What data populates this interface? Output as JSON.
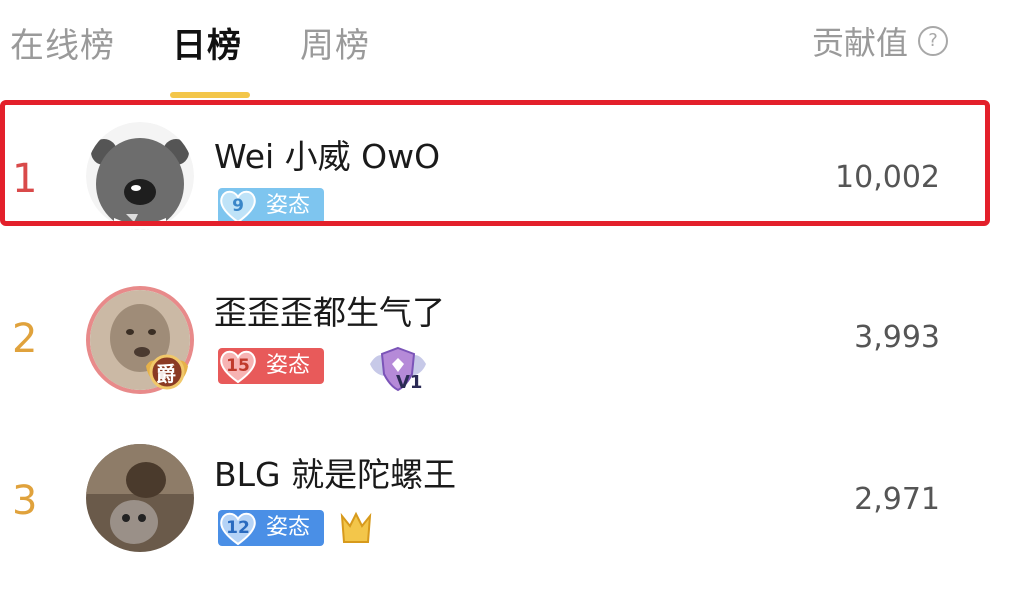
{
  "tabs": [
    {
      "label": "在线榜",
      "active": false
    },
    {
      "label": "日榜",
      "active": true
    },
    {
      "label": "周榜",
      "active": false
    }
  ],
  "contribution_label": "贡献值",
  "help_icon": "question-circle-icon",
  "accent_color": "#f3c64a",
  "highlight_color": "#e3202b",
  "rows": [
    {
      "rank": "1",
      "rank_color": "#d94a4a",
      "name": "Wei 小威 OwO",
      "badge_level": "9",
      "badge_label": "姿态",
      "badge_color": "#7ec5ef",
      "score": "10,002"
    },
    {
      "rank": "2",
      "rank_color": "#e0a23c",
      "name": "歪歪歪都生气了",
      "badge_level": "15",
      "badge_label": "姿态",
      "badge_color": "#e85a5a",
      "extra_badge_text": "V1",
      "extra_badge_icon_text": "爵",
      "score": "3,993"
    },
    {
      "rank": "3",
      "rank_color": "#e0a23c",
      "name": "BLG 就是陀螺王",
      "badge_level": "12",
      "badge_label": "姿态",
      "badge_color": "#4a8fe6",
      "score": "2,971"
    }
  ]
}
